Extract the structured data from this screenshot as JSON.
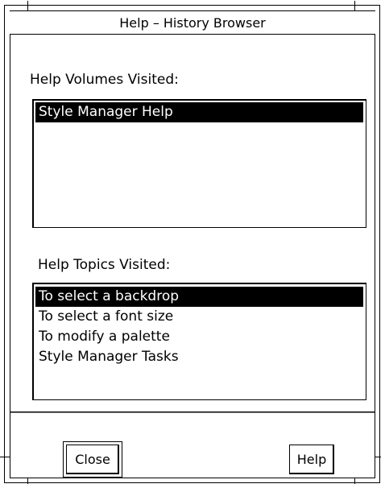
{
  "window": {
    "title": "Help – History Browser"
  },
  "volumes": {
    "label": "Help Volumes Visited:",
    "items": [
      {
        "label": "Style Manager Help",
        "selected": true
      }
    ]
  },
  "topics": {
    "label": "Help Topics Visited:",
    "items": [
      {
        "label": "To select a backdrop",
        "selected": true
      },
      {
        "label": "To select a font size",
        "selected": false
      },
      {
        "label": "To modify a palette",
        "selected": false
      },
      {
        "label": "Style Manager Tasks",
        "selected": false
      }
    ]
  },
  "buttons": {
    "close_label": "Close",
    "help_label": "Help"
  }
}
